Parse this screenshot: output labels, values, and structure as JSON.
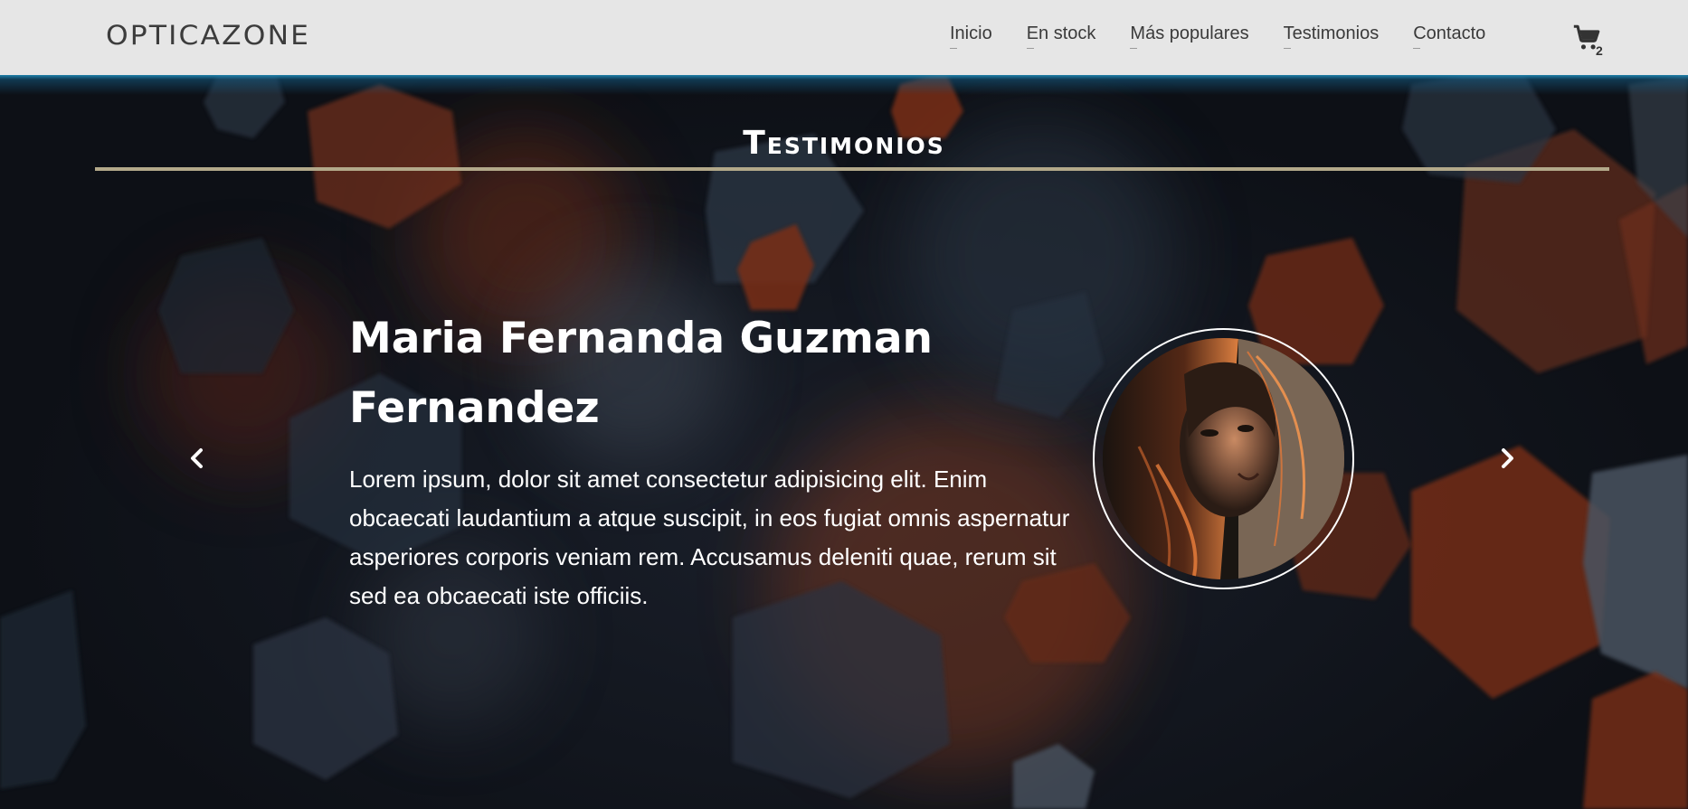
{
  "header": {
    "logo": "OPTICAZONE",
    "nav": [
      {
        "label": "Inicio"
      },
      {
        "label": "En stock"
      },
      {
        "label": "Más populares"
      },
      {
        "label": "Testimonios"
      },
      {
        "label": "Contacto"
      }
    ],
    "cart": {
      "icon": "cart-icon",
      "count": "2"
    }
  },
  "section": {
    "title": "Testimonios"
  },
  "testimonial": {
    "name": "Maria Fernanda Guzman Fernandez",
    "quote": "Lorem ipsum, dolor sit amet consectetur adipisicing elit. Enim obcaecati laudantium a atque suscipit, in eos fugiat omnis aspernatur asperiores corporis veniam rem. Accusamus deleniti quae, rerum sit sed ea obcaecati iste officiis.",
    "photo": "woman-portrait"
  },
  "carousel": {
    "prev_icon": "chevron-left-icon",
    "next_icon": "chevron-right-icon"
  },
  "colors": {
    "header_bg": "#e6e6e6",
    "accent_rule": "#b3a98a",
    "glow": "#1f86b2",
    "bokeh_orange": "#7a3218",
    "bokeh_slate": "#3a4450"
  }
}
